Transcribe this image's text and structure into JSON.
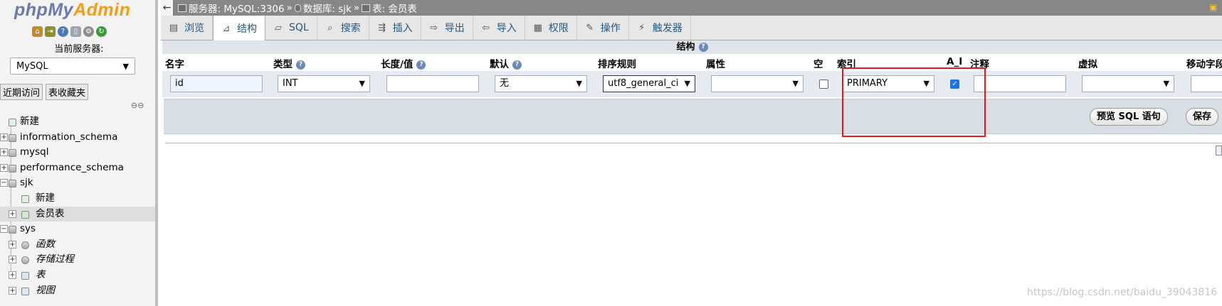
{
  "nav": {
    "logo_php": "php",
    "logo_my": "My",
    "logo_admin": "Admin",
    "server_label": "当前服务器:",
    "server_value": "MySQL",
    "tab_recent": "近期访问",
    "tab_favorites": "表收藏夹",
    "tree": [
      {
        "label": "新建"
      },
      {
        "label": "information_schema"
      },
      {
        "label": "mysql"
      },
      {
        "label": "performance_schema"
      },
      {
        "label": "sjk"
      },
      {
        "label": "新建"
      },
      {
        "label": "会员表"
      },
      {
        "label": "sys"
      },
      {
        "label": "函数"
      },
      {
        "label": "存储过程"
      },
      {
        "label": "表"
      },
      {
        "label": "视图"
      }
    ]
  },
  "breadcrumb": {
    "server": "服务器: MySQL:3306",
    "database": "数据库: sjk",
    "table": "表: 会员表",
    "separator": "»"
  },
  "tabs": [
    {
      "label": "浏览",
      "icon": "browse-icon"
    },
    {
      "label": "结构",
      "icon": "structure-icon"
    },
    {
      "label": "SQL",
      "icon": "sql-icon"
    },
    {
      "label": "搜索",
      "icon": "search-icon"
    },
    {
      "label": "插入",
      "icon": "insert-icon"
    },
    {
      "label": "导出",
      "icon": "export-icon"
    },
    {
      "label": "导入",
      "icon": "import-icon"
    },
    {
      "label": "权限",
      "icon": "privileges-icon"
    },
    {
      "label": "操作",
      "icon": "operations-icon"
    },
    {
      "label": "触发器",
      "icon": "triggers-icon"
    }
  ],
  "structure": {
    "title": "结构",
    "columns": {
      "name": "名字",
      "type": "类型",
      "length": "长度/值",
      "default": "默认",
      "collation": "排序规则",
      "attributes": "属性",
      "null": "空",
      "index": "索引",
      "ai": "A_I",
      "comment": "注释",
      "virtual": "虚拟",
      "move": "移动字段"
    },
    "row": {
      "name": "id",
      "type": "INT",
      "length": "",
      "default": "无",
      "collation": "utf8_general_ci",
      "attributes": "",
      "null_checked": false,
      "index": "PRIMARY",
      "ai_checked": true,
      "comment": "",
      "virtual": "",
      "move": ""
    },
    "preview_sql_button": "预览 SQL 语句",
    "save_button": "保存"
  },
  "watermark": "https://blog.csdn.net/baidu_39043816",
  "colors": {
    "accent_red": "#e41b1b",
    "tab_text": "#235a81",
    "topbar": "#878787"
  }
}
